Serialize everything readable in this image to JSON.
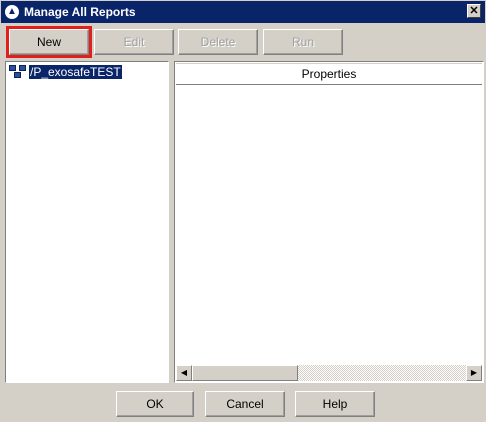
{
  "window": {
    "title": "Manage All Reports",
    "close_glyph": "✕",
    "app_icon_glyph": "▲"
  },
  "toolbar": {
    "new_label": "New",
    "edit_label": "Edit",
    "delete_label": "Delete",
    "run_label": "Run"
  },
  "tree": {
    "items": [
      {
        "label": "/P_exosafeTEST",
        "icon": "tree-network-icon"
      }
    ]
  },
  "properties": {
    "header": "Properties"
  },
  "footer": {
    "ok_label": "OK",
    "cancel_label": "Cancel",
    "help_label": "Help"
  },
  "colors": {
    "titlebar": "#0a246a",
    "highlight": "#e0201c",
    "face": "#d4d0c8"
  }
}
